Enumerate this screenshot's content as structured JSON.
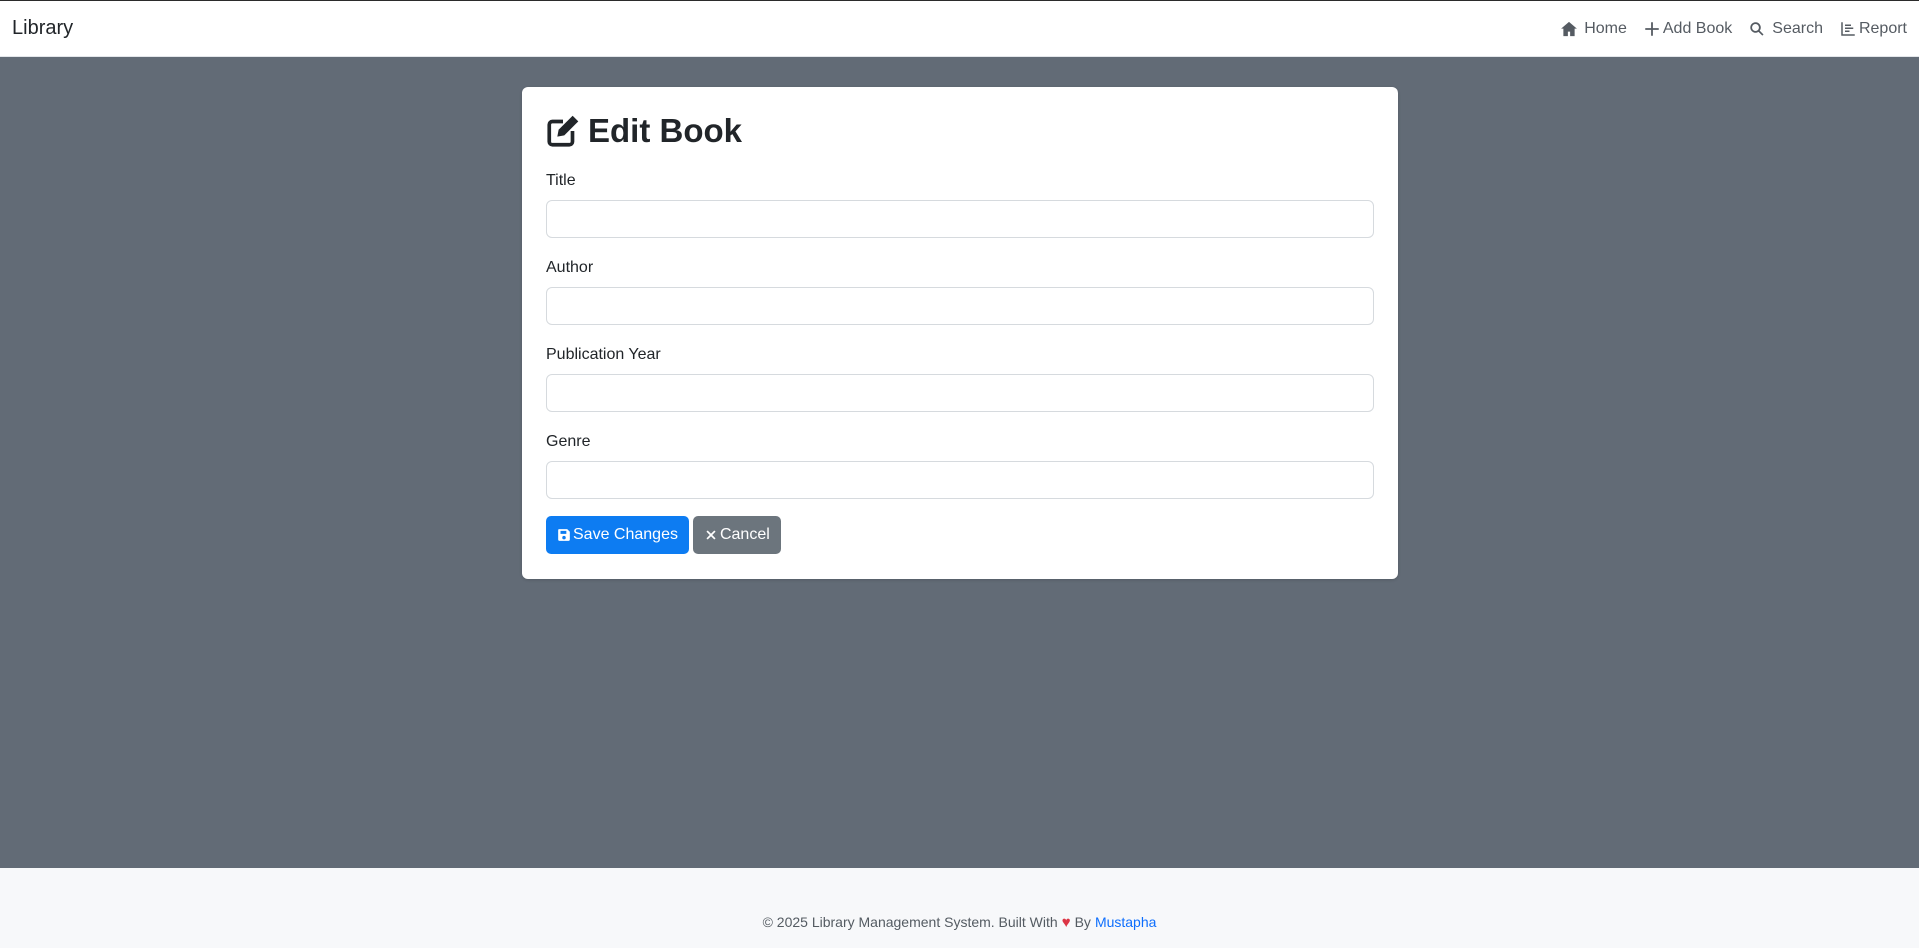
{
  "navbar": {
    "brand": "Library",
    "links": [
      {
        "label": "Home",
        "icon": "home-icon"
      },
      {
        "label": "Add Book",
        "icon": "plus-icon"
      },
      {
        "label": "Search",
        "icon": "search-icon"
      },
      {
        "label": "Report",
        "icon": "chart-icon"
      }
    ]
  },
  "form": {
    "title": "Edit Book",
    "fields": [
      {
        "label": "Title",
        "value": "",
        "placeholder": ""
      },
      {
        "label": "Author",
        "value": "",
        "placeholder": ""
      },
      {
        "label": "Publication Year",
        "value": "",
        "placeholder": ""
      },
      {
        "label": "Genre",
        "value": "",
        "placeholder": ""
      }
    ],
    "save_label": "Save Changes",
    "cancel_label": "Cancel"
  },
  "footer": {
    "text_before": "© 2025 Library Management System. Built With",
    "heart": "♥",
    "text_by": "By",
    "author": "Mustapha"
  },
  "colors": {
    "background": "#626b76",
    "primary": "#0d7cf2",
    "secondary": "#6c757d",
    "heart": "#dc3545",
    "link": "#0d6efd"
  }
}
